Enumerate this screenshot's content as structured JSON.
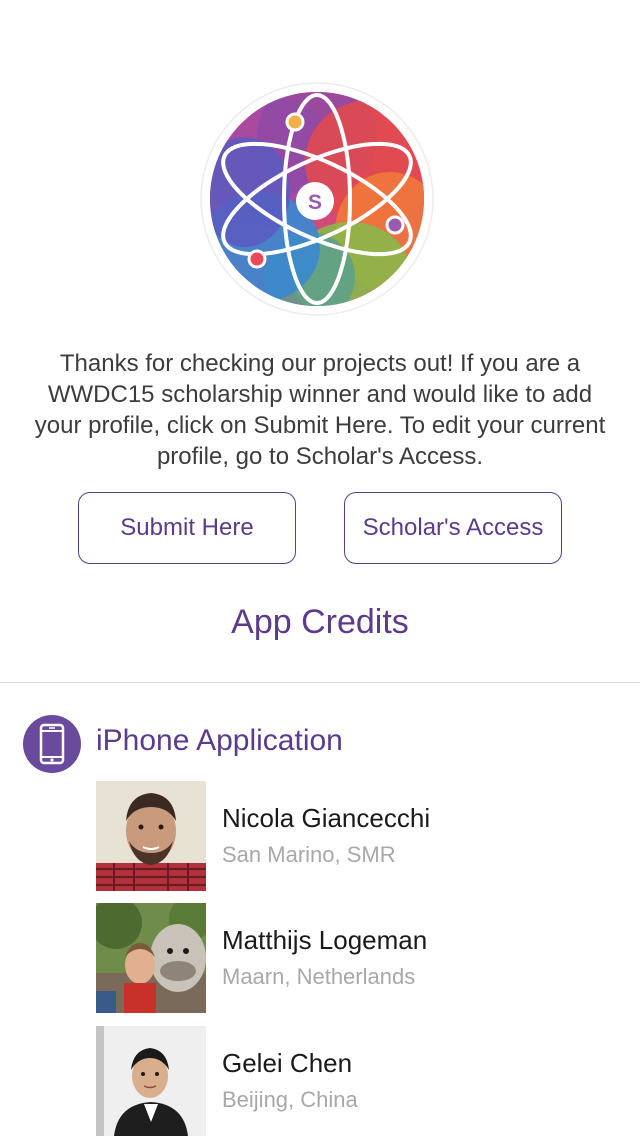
{
  "logo": {
    "letter": "S"
  },
  "intro_text": "Thanks for checking our projects out! If you are a WWDC15 scholarship winner and would like to add your profile, click on Submit Here. To edit your current profile, go to Scholar's Access.",
  "buttons": {
    "submit": "Submit Here",
    "scholar": "Scholar's Access"
  },
  "credits": {
    "title": "App Credits",
    "section": {
      "title": "iPhone Application",
      "icon": "iphone-icon"
    },
    "people": [
      {
        "name": "Nicola Giancecchi",
        "location": "San Marino, SMR"
      },
      {
        "name": "Matthijs Logeman",
        "location": "Maarn, Netherlands"
      },
      {
        "name": "Gelei Chen",
        "location": "Beijing, China"
      }
    ]
  },
  "colors": {
    "accent": "#5b3b8c",
    "icon_bg": "#6a4a9c",
    "location_text": "#a8a8a8"
  }
}
